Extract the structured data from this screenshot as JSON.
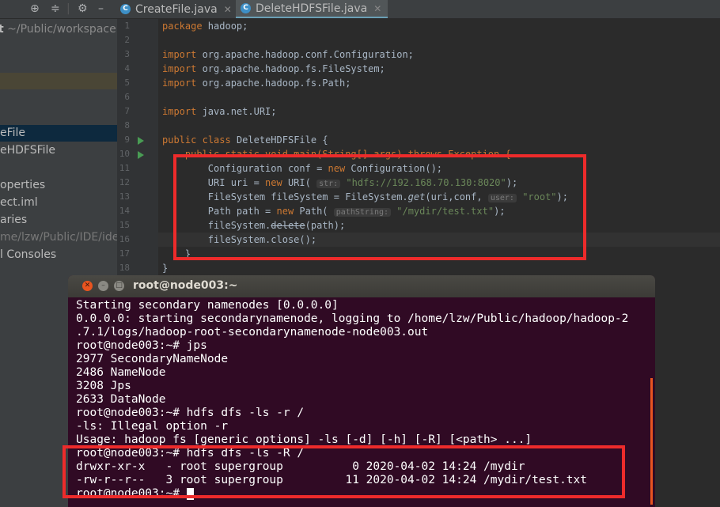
{
  "toolbar": {
    "icons": [
      "crosshair-icon",
      "collapse-icon",
      "pipe-separator",
      "gear-icon",
      "hide-icon"
    ]
  },
  "tabs": [
    {
      "label": "CreateFile.java",
      "icon": "java-class-icon"
    },
    {
      "label": "DeleteHDFSFile.java",
      "icon": "java-class-icon"
    }
  ],
  "sidebar": {
    "rows": [
      {
        "text": "t",
        "text2": "~/Public/workspace"
      },
      {
        "text": "eFile"
      },
      {
        "text": "eHDFSFile"
      },
      {
        "text": "operties"
      },
      {
        "text": "ect.iml"
      },
      {
        "text": "aries"
      },
      {
        "text": "me/lzw/Public/IDE/ide"
      },
      {
        "text": "l Consoles"
      }
    ]
  },
  "editor": {
    "line_numbers": [
      "1",
      "2",
      "3",
      "4",
      "5",
      "6",
      "7",
      "8",
      "9",
      "10",
      "11",
      "12",
      "13",
      "14",
      "15",
      "16",
      "17",
      "18"
    ],
    "lines": {
      "l1": {
        "kw": "package",
        "rest": " hadoop;"
      },
      "l3": {
        "kw": "import",
        "rest": " org.apache.hadoop.conf.Configuration;"
      },
      "l4": {
        "kw": "import",
        "rest": " org.apache.hadoop.fs.FileSystem;"
      },
      "l5": {
        "kw": "import",
        "rest": " org.apache.hadoop.fs.Path;"
      },
      "l7": {
        "kw": "import",
        "rest": " java.net.URI;"
      },
      "l9": {
        "kw1": "public",
        "kw2": "class",
        "rest": " DeleteHDFSFile {"
      },
      "l10": {
        "text": "    public static void main(String[] args) throws Exception {"
      },
      "l11": {
        "a": "        Configuration conf = ",
        "kw": "new",
        "b": " Configuration();"
      },
      "l12": {
        "a": "        URI uri = ",
        "kw": "new",
        "b": " URI(",
        "hint": "str:",
        "s": "\"hdfs://192.168.70.130:8020\"",
        "c": ");"
      },
      "l13": {
        "a": "        FileSystem fileSystem = FileSystem.",
        "fn": "get",
        "b": "(uri,conf,",
        "hint": "user:",
        "s": "\"root\"",
        "c": ");"
      },
      "l14": {
        "a": "        Path path = ",
        "kw": "new",
        "b": " Path(",
        "hint": "pathString:",
        "s": "\"/mydir/test.txt\"",
        "c": ");"
      },
      "l15": {
        "a": "        fileSystem.",
        "st": "delete",
        "b": "(path);"
      },
      "l16": {
        "text": "        fileSystem.close();"
      },
      "l17": {
        "text": "    }"
      },
      "l18": {
        "text": "}"
      }
    }
  },
  "terminal": {
    "title": "root@node003:~",
    "lines": [
      "Starting secondary namenodes [0.0.0.0]",
      "0.0.0.0: starting secondarynamenode, logging to /home/lzw/Public/hadoop/hadoop-2",
      ".7.1/logs/hadoop-root-secondarynamenode-node003.out",
      "root@node003:~# jps",
      "2977 SecondaryNameNode",
      "2486 NameNode",
      "3208 Jps",
      "2633 DataNode",
      "root@node003:~# hdfs dfs -ls -r /",
      "-ls: Illegal option -r",
      "Usage: hadoop fs [generic options] -ls [-d] [-h] [-R] [<path> ...]",
      "root@node003:~# hdfs dfs -ls -R /",
      "drwxr-xr-x   - root supergroup          0 2020-04-02 14:24 /mydir",
      "-rw-r--r--   3 root supergroup         11 2020-04-02 14:24 /mydir/test.txt",
      "root@node003:~# "
    ],
    "window_buttons": [
      "close-icon",
      "minimize-icon",
      "maximize-icon"
    ]
  },
  "colors": {
    "keyword": "#cc7832",
    "string": "#6a8759",
    "highlight_box": "#ed2b2b",
    "terminal_bg": "#300a24"
  }
}
